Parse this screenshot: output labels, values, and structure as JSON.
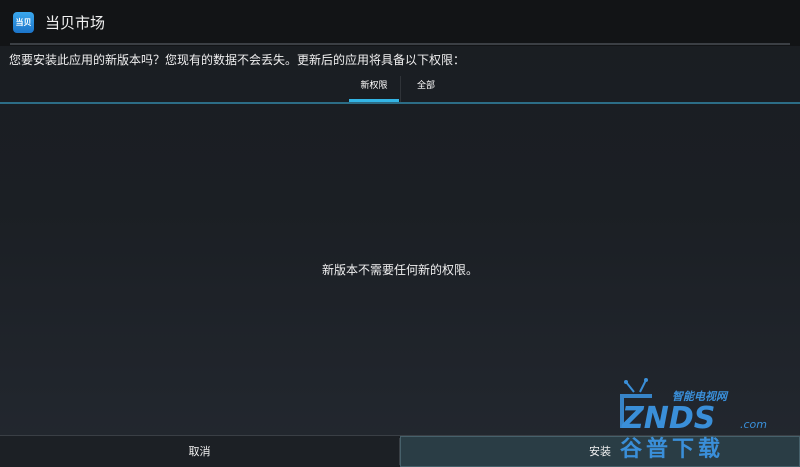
{
  "window": {
    "app_icon_text": "当贝",
    "title": "当贝市场"
  },
  "dialog": {
    "prompt": "您要安装此应用的新版本吗？您现有的数据不会丢失。更新后的应用将具备以下权限：",
    "tabs": [
      {
        "label": "新权限",
        "selected": true
      },
      {
        "label": "全部",
        "selected": false
      }
    ],
    "empty_message": "新版本不需要任何新的权限。"
  },
  "buttons": {
    "cancel": "取消",
    "install": "安装"
  },
  "watermark": {
    "line1": "智能电视网",
    "brand": "ZNDS",
    "domain": ".com",
    "line2": "谷普下载"
  },
  "colors": {
    "accent": "#33b5e5",
    "titlebar": "#121416",
    "background": "#1b1f24",
    "watermark_blue": "#3a8fd9"
  }
}
